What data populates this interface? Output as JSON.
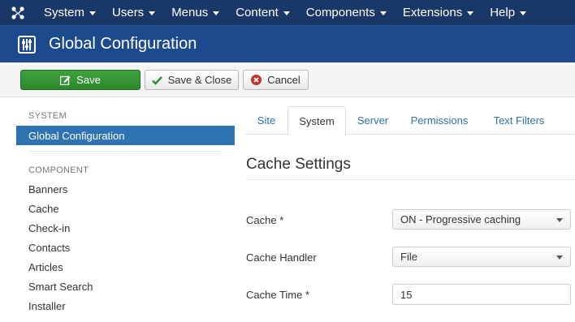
{
  "topnav": {
    "items": [
      {
        "label": "System"
      },
      {
        "label": "Users"
      },
      {
        "label": "Menus"
      },
      {
        "label": "Content"
      },
      {
        "label": "Components"
      },
      {
        "label": "Extensions"
      },
      {
        "label": "Help"
      }
    ]
  },
  "header": {
    "title": "Global Configuration",
    "icon": "equalizer-icon"
  },
  "toolbar": {
    "save_label": "Save",
    "save_close_label": "Save & Close",
    "cancel_label": "Cancel"
  },
  "sidebar": {
    "system_heading": "SYSTEM",
    "active_item": "Global Configuration",
    "component_heading": "COMPONENT",
    "items": [
      {
        "label": "Banners"
      },
      {
        "label": "Cache"
      },
      {
        "label": "Check-in"
      },
      {
        "label": "Contacts"
      },
      {
        "label": "Articles"
      },
      {
        "label": "Smart Search"
      },
      {
        "label": "Installer"
      }
    ]
  },
  "tabs": [
    {
      "label": "Site",
      "active": false
    },
    {
      "label": "System",
      "active": true
    },
    {
      "label": "Server",
      "active": false
    },
    {
      "label": "Permissions",
      "active": false
    },
    {
      "label": "Text Filters",
      "active": false
    }
  ],
  "main": {
    "section_title": "Cache Settings",
    "fields": [
      {
        "label": "Cache *",
        "value": "ON - Progressive caching"
      },
      {
        "label": "Cache Handler",
        "value": "File"
      },
      {
        "label": "Cache Time *",
        "value": "15"
      }
    ]
  },
  "colors": {
    "nav_bg": "#1a3867",
    "header_bg": "#1d4a8c",
    "save_green": "#2f8f2f",
    "active_blue": "#2f73b3",
    "link_blue": "#2f6fa8"
  }
}
